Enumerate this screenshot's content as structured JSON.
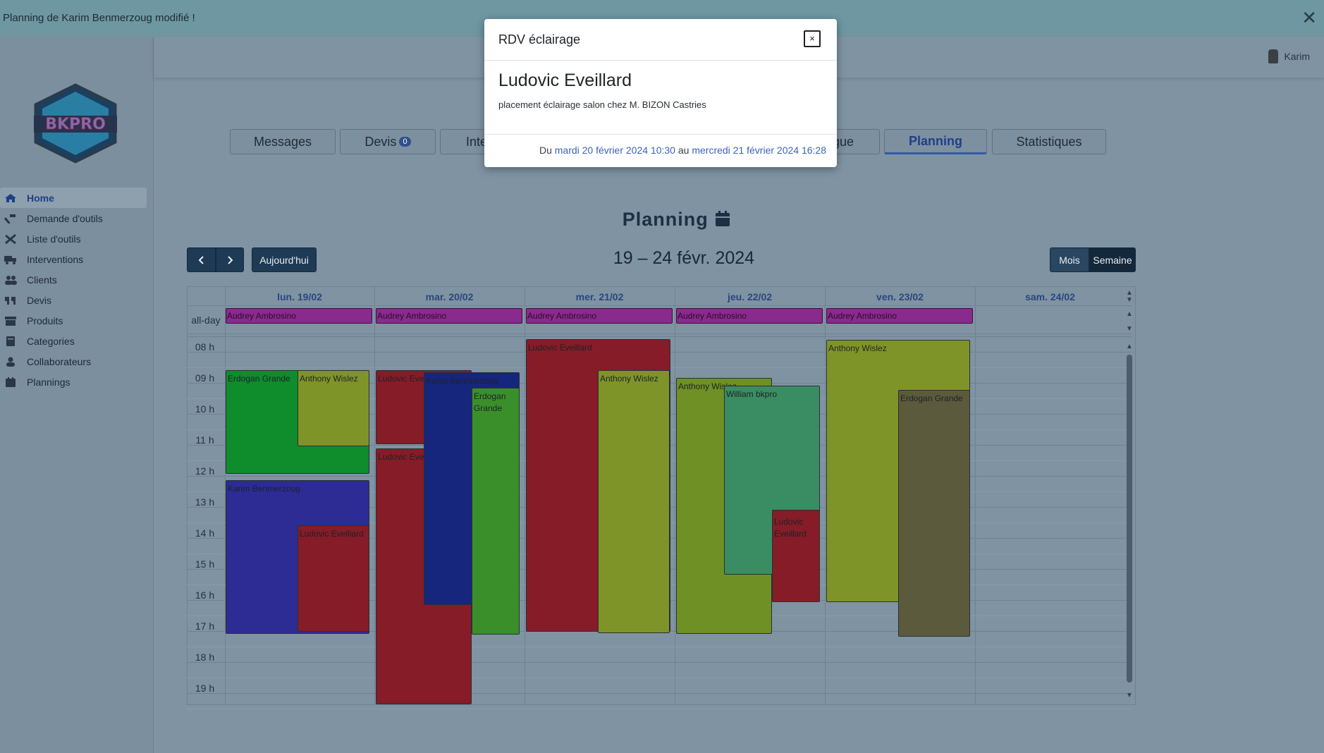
{
  "notification": {
    "text": "Planning de Karim Benmerzoug modifié !",
    "close": "✕"
  },
  "user": {
    "name": "Karim"
  },
  "sidebar": {
    "items": [
      {
        "label": "Home",
        "icon": "home-icon",
        "active": true
      },
      {
        "label": "Demande d'outils",
        "icon": "hammer-icon"
      },
      {
        "label": "Liste d'outils",
        "icon": "tools-icon"
      },
      {
        "label": "Interventions",
        "icon": "truck-icon"
      },
      {
        "label": "Clients",
        "icon": "users-icon"
      },
      {
        "label": "Devis",
        "icon": "quote-icon"
      },
      {
        "label": "Produits",
        "icon": "box-icon"
      },
      {
        "label": "Categories",
        "icon": "book-icon"
      },
      {
        "label": "Collaborateurs",
        "icon": "user-icon"
      },
      {
        "label": "Plannings",
        "icon": "calendar-icon"
      }
    ]
  },
  "tabs": {
    "messages": "Messages",
    "devis": "Devis",
    "devis_badge": "0",
    "interventions": "Inte",
    "catalogue": "gue",
    "planning": "Planning",
    "statistiques": "Statistiques"
  },
  "planning": {
    "title": "Planning",
    "today_button": "Aujourd'hui",
    "range": "19 – 24 févr. 2024",
    "view_month": "Mois",
    "view_week": "Semaine",
    "allday_label": "all-day",
    "days": [
      "lun. 19/02",
      "mar. 20/02",
      "mer. 21/02",
      "jeu. 22/02",
      "ven. 23/02",
      "sam. 24/02"
    ],
    "hours": [
      "08 h",
      "09 h",
      "10 h",
      "11 h",
      "12 h",
      "13 h",
      "14 h",
      "15 h",
      "16 h",
      "17 h",
      "18 h",
      "19 h"
    ],
    "allday_events": [
      "Audrey Ambrosino",
      "Audrey Ambrosino",
      "Audrey Ambrosino",
      "Audrey Ambrosino",
      "Audrey Ambrosino"
    ],
    "events": [
      {
        "name": "Erdogan Grande",
        "color": "#0f8c2c"
      },
      {
        "name": "Anthony Wislez",
        "color": "#7f9428"
      },
      {
        "name": "Karim Benmerzoug",
        "color": "#2c2c94"
      },
      {
        "name": "Ludovic Eveillard",
        "color": "#851c27"
      },
      {
        "name": "Ludovic Eveillard",
        "color": "#851c27"
      },
      {
        "name": "Ludovic Eveillard",
        "color": "#851c27"
      },
      {
        "name": "Karim Benmerzoug",
        "color": "#16267d"
      },
      {
        "name": "Erdogan Grande",
        "color": "#3a8f2a"
      },
      {
        "name": "Ludovic Eveillard",
        "color": "#851c27"
      },
      {
        "name": "Anthony Wislez",
        "color": "#7f9428"
      },
      {
        "name": "Anthony Wislez",
        "color": "#6e9025"
      },
      {
        "name": "William bkpro",
        "color": "#3a8d62"
      },
      {
        "name": "Ludovic Eveillard",
        "color": "#851c27"
      },
      {
        "name": "Anthony Wislez",
        "color": "#7f9428"
      },
      {
        "name": "Erdogan Grande",
        "color": "#5c5a3c"
      }
    ]
  },
  "modal": {
    "title": "RDV éclairage",
    "close": "×",
    "name": "Ludovic Eveillard",
    "description": "placement éclairage salon chez M. BIZON Castries",
    "date_prefix": "Du",
    "date_start": "mardi 20 février 2024 10:30",
    "date_mid": "au",
    "date_end": "mercredi 21 février 2024 16:28"
  }
}
